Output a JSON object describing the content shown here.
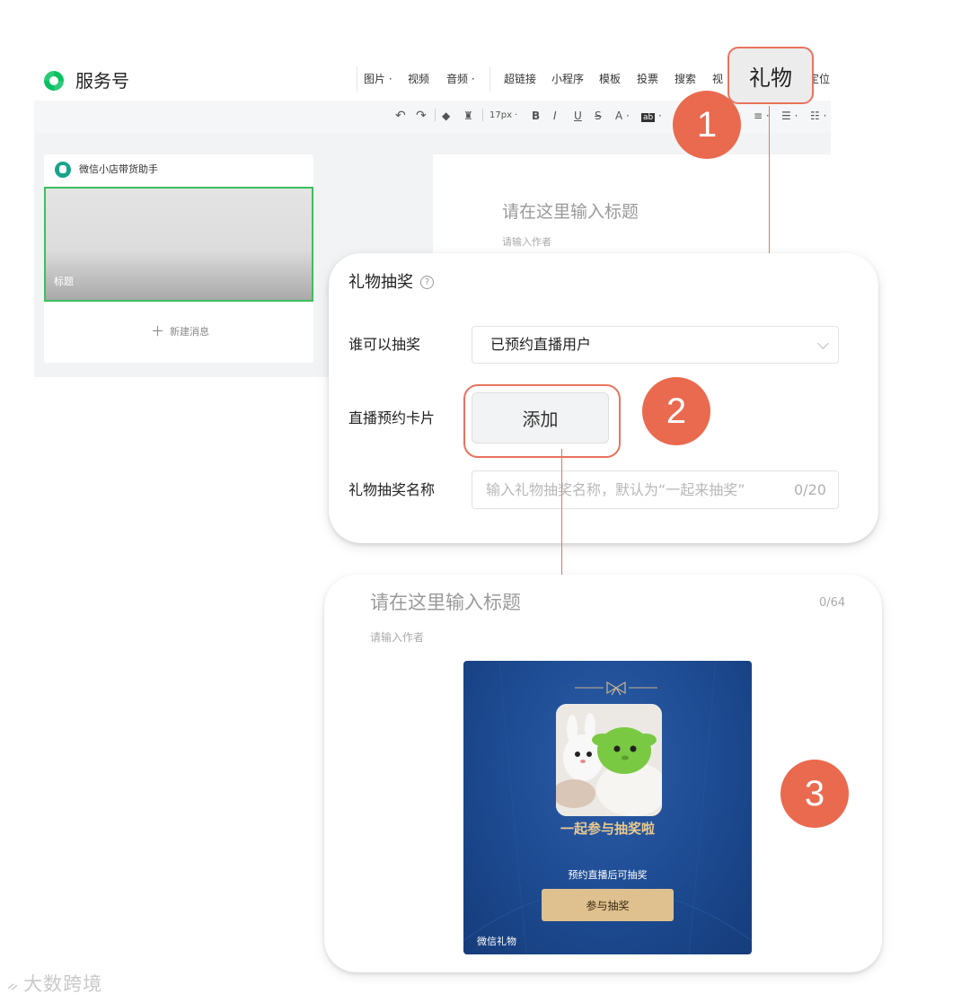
{
  "editor": {
    "brand": "服务号",
    "menu": [
      "图片 ·",
      "视频",
      "音频 ·",
      "超链接",
      "小程序",
      "模板",
      "投票",
      "搜索",
      "视",
      "定位"
    ],
    "toolbar": {
      "font_size": "17px",
      "bold": "B",
      "italic": "I",
      "underline": "U",
      "strike": "S",
      "font_color": "A",
      "highlight": "ab"
    },
    "account_name": "微信小店带货助手",
    "cover_title": "标题",
    "new_message": "新建消息",
    "title_placeholder": "请在这里输入标题",
    "author_placeholder": "请输入作者"
  },
  "annotations": {
    "gift_label": "礼物",
    "badge1": "1",
    "badge2": "2",
    "badge3": "3",
    "accent": "#ea6a4f"
  },
  "popup": {
    "title": "礼物抽奖",
    "help": "?",
    "rows": [
      {
        "label": "谁可以抽奖",
        "value": "已预约直播用户"
      },
      {
        "label": "直播预约卡片",
        "button": "添加"
      },
      {
        "label": "礼物抽奖名称",
        "placeholder": "输入礼物抽奖名称，默认为“一起来抽奖”",
        "count": "0/20"
      }
    ]
  },
  "result": {
    "title_placeholder": "请在这里输入标题",
    "title_count": "0/64",
    "author_placeholder": "请输入作者",
    "card": {
      "heading": "一起参与抽奖啦",
      "subtitle": "预约直播后可抽奖",
      "button": "参与抽奖",
      "brand": "微信礼物"
    }
  },
  "watermark": "大数跨境",
  "colors": {
    "brand_green": "#07c160",
    "card_blue": "#1d4a91",
    "gold": "#dfc08f"
  }
}
